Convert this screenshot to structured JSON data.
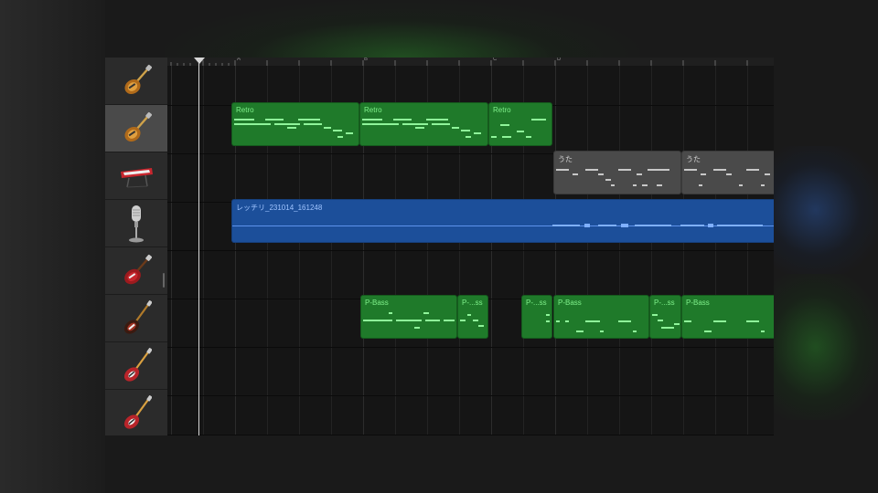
{
  "colors": {
    "midi_region": "#1f7a2a",
    "midi_note": "#8ff59a",
    "inactive_region": "#4a4a4a",
    "audio_region": "#1c4f9a",
    "selected_track": "#4a4a4a",
    "playhead": "#d8d8d8"
  },
  "ruler": {
    "markers": [
      "A",
      "B",
      "C",
      "D"
    ]
  },
  "tracks": [
    {
      "icon": "electric-guitar-sunburst-icon",
      "selected": false
    },
    {
      "icon": "electric-guitar-sunburst-icon",
      "selected": true
    },
    {
      "icon": "synth-keyboard-icon",
      "selected": false
    },
    {
      "icon": "microphone-icon",
      "selected": false
    },
    {
      "icon": "electric-guitar-red-icon",
      "selected": false
    },
    {
      "icon": "bass-guitar-icon",
      "selected": false
    },
    {
      "icon": "bass-guitar-icon",
      "selected": false
    },
    {
      "icon": "bass-guitar-icon",
      "selected": false
    }
  ],
  "regions": {
    "retro1": "Retro",
    "retro2": "Retro",
    "retro3": "Retro",
    "uta1": "うた",
    "uta2": "うた",
    "audio1": "レッチリ_231014_161248",
    "pbass1": "P-Bass",
    "pbass2": "P-...ss",
    "pbass3": "P-...ss",
    "pbass4": "P-Bass",
    "pbass5": "P-...ss",
    "pbass6": "P-Bass"
  }
}
